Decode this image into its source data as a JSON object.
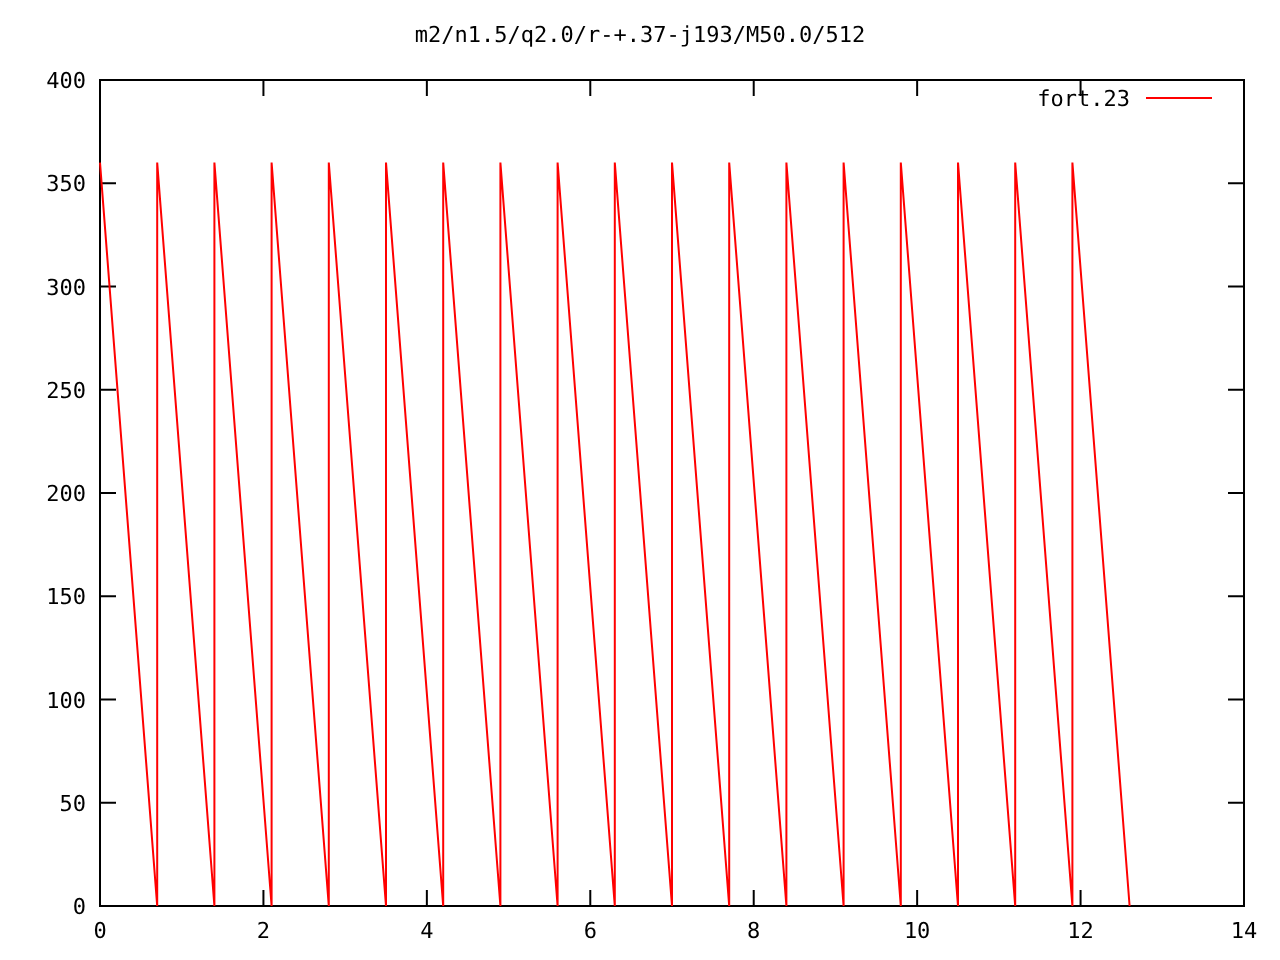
{
  "chart_data": {
    "type": "line",
    "title": "m2/n1.5/q2.0/r-+.37-j193/M50.0/512",
    "xlim": [
      0,
      14
    ],
    "ylim": [
      0,
      400
    ],
    "xticks": [
      0,
      2,
      4,
      6,
      8,
      10,
      12,
      14
    ],
    "yticks": [
      0,
      50,
      100,
      150,
      200,
      250,
      300,
      350,
      400
    ],
    "x": [
      0,
      0.7,
      0.7,
      1.4,
      1.4,
      2.1,
      2.1,
      2.8,
      2.8,
      3.5,
      3.5,
      4.2,
      4.2,
      4.9,
      4.9,
      5.6,
      5.6,
      6.3,
      6.3,
      7,
      7,
      7.7,
      7.7,
      8.4,
      8.4,
      9.1,
      9.1,
      9.8,
      9.8,
      10.5,
      10.5,
      11.2,
      11.2,
      11.9,
      11.9,
      12.6
    ],
    "series": [
      {
        "name": "fort.23",
        "color": "#ff0000",
        "values": [
          360,
          0,
          360,
          0,
          360,
          0,
          360,
          0,
          360,
          0,
          360,
          0,
          360,
          0,
          360,
          0,
          360,
          0,
          360,
          0,
          360,
          0,
          360,
          0,
          360,
          0,
          360,
          0,
          360,
          0,
          360,
          0,
          360,
          0,
          360,
          0
        ]
      }
    ]
  }
}
